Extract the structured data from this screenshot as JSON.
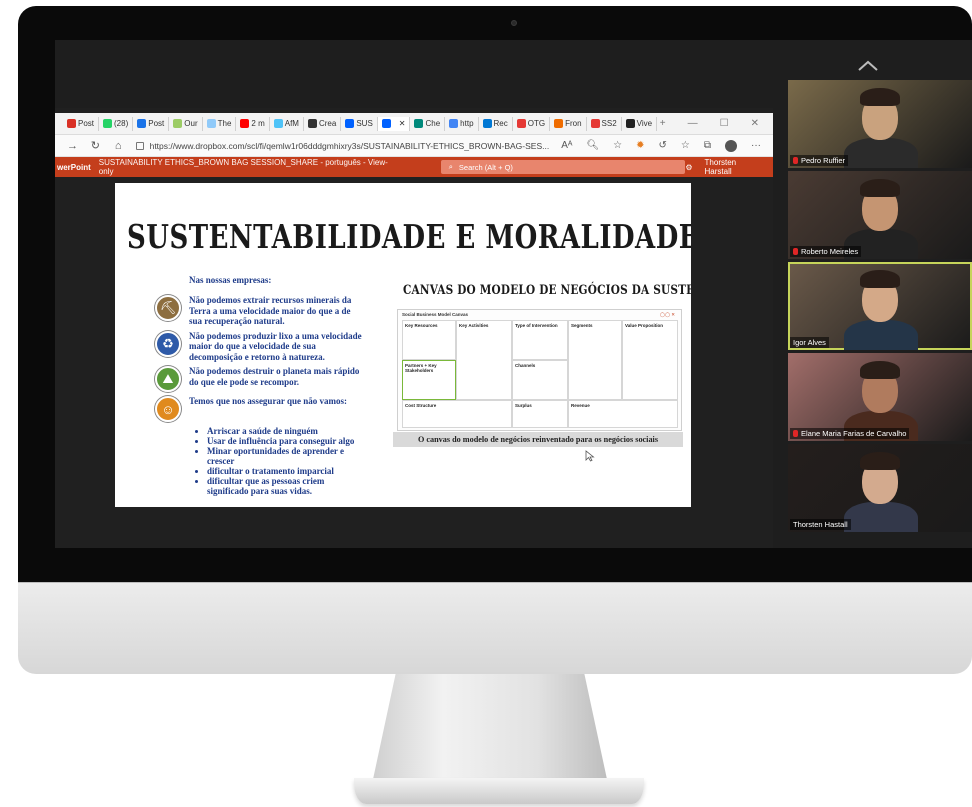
{
  "browser": {
    "tabs": [
      {
        "label": "Post",
        "icon": "gmail-icon",
        "color": "#d93025"
      },
      {
        "label": "(28)",
        "icon": "whatsapp-icon",
        "color": "#25d366"
      },
      {
        "label": "Post",
        "icon": "outlook-icon",
        "color": "#1a73e8"
      },
      {
        "label": "Our",
        "icon": "leaf-icon",
        "color": "#9ccc65"
      },
      {
        "label": "The",
        "icon": "page-icon",
        "color": "#90caf9"
      },
      {
        "label": "2 m",
        "icon": "youtube-icon",
        "color": "#ff0000"
      },
      {
        "label": "AfM",
        "icon": "doc-icon",
        "color": "#4fc3f7"
      },
      {
        "label": "Crea",
        "icon": "notion-icon",
        "color": "#333333"
      },
      {
        "label": "SUS",
        "icon": "dropbox-icon",
        "color": "#0061ff"
      },
      {
        "label": "",
        "icon": "dropbox-icon",
        "color": "#0061ff"
      },
      {
        "label": "Che",
        "icon": "teal-icon",
        "color": "#00897b"
      },
      {
        "label": "http",
        "icon": "web-icon",
        "color": "#4285f4"
      },
      {
        "label": "Rec",
        "icon": "cloud-icon",
        "color": "#0078d4"
      },
      {
        "label": "OTG",
        "icon": "flower-icon",
        "color": "#e53935"
      },
      {
        "label": "Fron",
        "icon": "orange-icon",
        "color": "#ef6c00"
      },
      {
        "label": "SS2",
        "icon": "pdf-icon",
        "color": "#e53935"
      },
      {
        "label": "Vive",
        "icon": "black-icon",
        "color": "#222222"
      }
    ],
    "url": "https://www.dropbox.com/scl/fi/qemlw1r06dddgmhixry3s/SUSTAINABILITY-ETHICS_BROWN-BAG-SES..."
  },
  "powerpoint": {
    "app_label": "werPoint",
    "doc_title": "SUSTAINABILITY ETHICS_BROWN BAG SESSION_SHARE - português - View-only",
    "search_placeholder": "Search (Alt + Q)",
    "user": "Thorsten Harstall"
  },
  "slide": {
    "title": "SUSTENTABILIDADE E MORALIDADE DO PAPEL",
    "subheading": "Nas nossas empresas:",
    "items": [
      {
        "icon": "mining-icon",
        "color": "#8d6e3f",
        "text": "Não podemos extrair recursos minerais da Terra a uma velocidade maior do que a de sua recuperação natural."
      },
      {
        "icon": "recycle-icon",
        "color": "#2e5aa8",
        "text": "Não podemos produzir lixo a uma velocidade maior do que a velocidade de sua decomposição e retorno à natureza."
      },
      {
        "icon": "landscape-icon",
        "color": "#5a9a3a",
        "text": "Não podemos destruir o planeta mais rápido do que ele pode se recompor."
      },
      {
        "icon": "people-icon",
        "color": "#e08a1e",
        "text": "Temos que nos assegurar que não vamos:"
      }
    ],
    "bullets": [
      "Arriscar a saúde de ninguém",
      "Usar de influência para conseguir algo",
      "Minar oportunidades de aprender e crescer",
      "dificultar o tratamento imparcial",
      "dificultar que as pessoas criem significado para suas vidas."
    ],
    "canvas_title": "CANVAS DO MODELO DE NEGÓCIOS DA SUSTENTABILIDADE",
    "canvas_header": "Social Business Model Canvas",
    "canvas_cells": {
      "key_resources": "Key Resources",
      "key_activities": "Key Activities",
      "type_of_intervention": "Type of Intervention",
      "segments": "Segments",
      "value_proposition": "Value Proposition",
      "partners": "Partners + Key Stakeholders",
      "channels": "Channels",
      "cost_structure": "Cost Structure",
      "surplus": "Surplus",
      "revenue": "Revenue"
    },
    "caption": "O canvas do modelo de negócios reinventado para os negócios sociais"
  },
  "participants": [
    {
      "name": "Pedro Ruffier",
      "muted": true,
      "bg": "#7a6a4a",
      "skin": "#c9a27e",
      "shirt": "#2b2b2b"
    },
    {
      "name": "Roberto Meireles",
      "muted": true,
      "bg": "#4a3b33",
      "skin": "#c59572",
      "shirt": "#222222"
    },
    {
      "name": "Igor Alves",
      "muted": false,
      "bg": "#6b5a4a",
      "skin": "#d4a988",
      "shirt": "#243548"
    },
    {
      "name": "Elane Maria Farias de Carvalho",
      "muted": true,
      "bg": "#a26e6a",
      "skin": "#b07b5e",
      "shirt": "#4a2a1e"
    },
    {
      "name": "Thorsten Hastall",
      "muted": false,
      "bg": "#241e1c",
      "skin": "#d3aa8e",
      "shirt": "#33384a"
    }
  ]
}
